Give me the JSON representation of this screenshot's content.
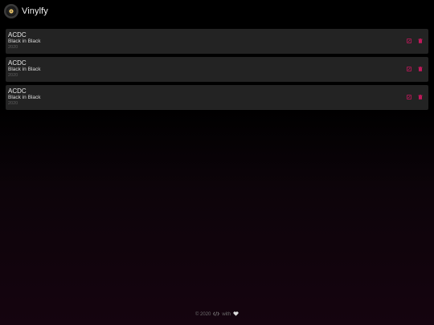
{
  "header": {
    "title": "Vinylfy",
    "logo_icon": "vinyl-record-icon"
  },
  "records": [
    {
      "artist": "ACDC",
      "album": "Black in Black",
      "year": "2020"
    },
    {
      "artist": "ACDC",
      "album": "Black in Black",
      "year": "2020"
    },
    {
      "artist": "ACDC",
      "album": "Black in Black",
      "year": "2020"
    }
  ],
  "actions": {
    "edit_icon": "edit-icon",
    "delete_icon": "trash-icon"
  },
  "footer": {
    "copyright": "© 2020",
    "made_with": "with",
    "code_icon": "code-icon",
    "heart_icon": "heart-icon"
  },
  "colors": {
    "accent": "#c2185b",
    "card_background": "#232323",
    "page_background": "#000000",
    "bottom_tint": "#15040f"
  }
}
